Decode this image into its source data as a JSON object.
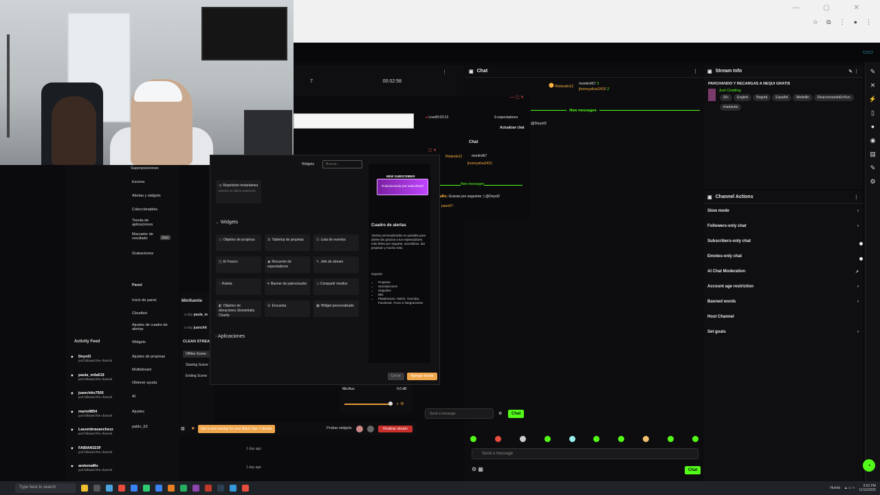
{
  "studio": {
    "timer_left": "7",
    "timer_mid": "00:02:58",
    "chat_title": "Chat",
    "stream_info_title": "Stream Info",
    "stream_title": "PARCHANDO Y RECARGAS A NEQUI GRATIS",
    "category": "Just Chatting",
    "tags": [
      "18+",
      "English",
      "Bogotá",
      "Español",
      "Medellin",
      "ReaccionandoEnVivo",
      "charlando"
    ],
    "channel_actions_title": "Channel Actions",
    "channel_actions": [
      {
        "label": "Slow mode",
        "ctrl": "›"
      },
      {
        "label": "Followers-only chat",
        "ctrl": "›"
      },
      {
        "label": "Subscribers-only chat",
        "ctrl": "toggle"
      },
      {
        "label": "Emotes-only chat",
        "ctrl": "toggle"
      },
      {
        "label": "AI Chat Moderation",
        "ctrl": "↗"
      },
      {
        "label": "Account age restriction",
        "ctrl": "›"
      },
      {
        "label": "Banned words",
        "ctrl": "›"
      },
      {
        "label": "Host Channel",
        "ctrl": ""
      },
      {
        "label": "Set goals",
        "ctrl": "›"
      }
    ],
    "chat_users": [
      {
        "name": "Rolando12",
        "count": ""
      },
      {
        "name": "montrol67",
        "count": "3"
      },
      {
        "name": "jhonnysilva2415",
        "count": "2"
      }
    ],
    "new_messages": "New messages",
    "chat_msg": "@Deyol3",
    "send_placeholder": "Send a message",
    "chat_button": "Chat"
  },
  "mini_chat": {
    "live": "Live00:03:13",
    "viewers": "9 espectadores",
    "update": "Actualizar chat",
    "title": "Chat",
    "users": [
      "Rolando12",
      "montrol67",
      "jhonnysilva2415"
    ],
    "user_counts": [
      "3",
      "2"
    ],
    "new_messages": "New messages",
    "msg1": "Gracias por seguirme :) @Deyol3",
    "msg1_prefix": "aRo:",
    "msg2": "paso67:"
  },
  "sidebar": {
    "nav": [
      "Superposiciones",
      "Escena",
      "Alertas y widgets",
      "Colecciónables",
      "Tienda de aplicaciones",
      "Marcador de resultado",
      "Grabaciones",
      "Panel",
      "Inicio de panel",
      "Cloudbot",
      "Ajustes de cuadro de alertas",
      "Widgets",
      "Ajustes de propinas",
      "Multistream",
      "Obtener ayuda",
      "AI",
      "Ajustes",
      "pablo_53"
    ],
    "beta": "beta",
    "activity_title": "Activity Feed",
    "activity": [
      {
        "name": "Deyol3",
        "sub": "just followed the channel"
      },
      {
        "name": "paula_mila619",
        "sub": "just followed the channel"
      },
      {
        "name": "juanchito7505",
        "sub": "just followed the channel"
      },
      {
        "name": "mario9854",
        "sub": "just followed the channel"
      },
      {
        "name": "Lasombrasanchezz",
        "sub": "just followed the channel"
      },
      {
        "name": "FABIAN323F",
        "sub": "just followed the channel"
      },
      {
        "name": "andemaMo",
        "sub": "just followed the channel"
      }
    ],
    "time_labels": [
      "1 day ago",
      "1 day ago"
    ]
  },
  "scenes": {
    "title": "Minifuente",
    "items": [
      "paula_m",
      "juanchit"
    ],
    "ago": [
      "a day",
      "a day"
    ],
    "clean_stream": "CLEAN STREA",
    "scene_list": [
      "Offline Scene",
      "Starting Scene",
      "Ending Scene"
    ]
  },
  "modal": {
    "tab": "Widgets",
    "search_placeholder": "Buscar...",
    "top_item": "Repetición instantánea",
    "top_desc": "Mostrar la última repetición",
    "section_widgets": "Widgets",
    "widgets": [
      "Objetivo de propinas",
      "Tabletop de propinas",
      "Lista de eventos",
      "El Frasco",
      "Recuento de espectadores",
      "Jefe de stream",
      "Ruleta",
      "Banner de patrocinador",
      "Compartir medios",
      "Objetivo de donaciones Streamlabs Charity",
      "Encuesta",
      "Widget personalizado"
    ],
    "section_apps": "Aplicaciones",
    "preview_badge": "NEW SUBSCRIBER",
    "preview_alert": "Rolandoranda just subscribed!",
    "preview_title": "Cuadro de alertas",
    "preview_desc": "Alertas personalizadas en pantalla para darles las gracias a tus espectadores más fieles por seguirte, suscribirse, dar propinas y mucho más.",
    "supports_label": "Soporte:",
    "supports": [
      "Propinas",
      "Suscripciones",
      "Seguidos",
      "Bits",
      "Plataformas: Twitch, YouTube, Facebook, Trovo e integraciones"
    ],
    "close": "Cerrar",
    "add": "Agregar fuente"
  },
  "bottom": {
    "mic_label": "Mic/Aux",
    "db": "0.0 dB",
    "promo": "Get a new overlay for your Black Ops 7 stream",
    "test_widgets": "Probar widgets",
    "end_stream": "Finalizar stream"
  },
  "taskbar": {
    "search": "Type here to search",
    "weather": "Humid",
    "time": "3:52 PM",
    "date": "11/16/2025"
  },
  "colors": {
    "accent_green": "#53fc18",
    "accent_orange": "#f0a64b",
    "end_red": "#c9302c"
  }
}
